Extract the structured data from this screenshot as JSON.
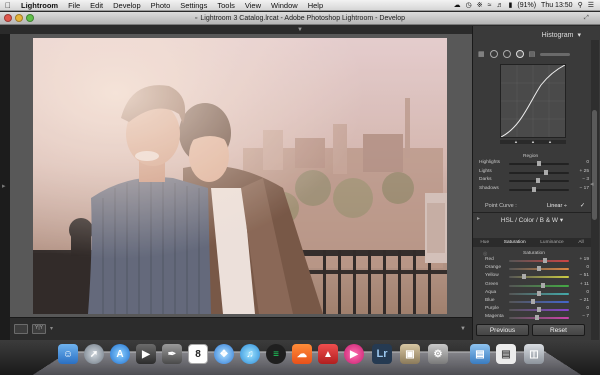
{
  "menubar": {
    "apple": "",
    "items": [
      "Lightroom",
      "File",
      "Edit",
      "Develop",
      "Photo",
      "Settings",
      "Tools",
      "View",
      "Window",
      "Help"
    ],
    "battery": "(91%)",
    "clock": "Thu 13:50"
  },
  "window": {
    "title": "Lightroom 3 Catalog.lrcat - Adobe Photoshop Lightroom - Develop"
  },
  "histogram": {
    "title": "Histogram"
  },
  "tone_curve": {
    "region_label": "Region",
    "sliders": [
      {
        "label": "Highlights",
        "value": "0",
        "level": 0.5
      },
      {
        "label": "Lights",
        "value": "+ 25",
        "level": 0.62
      },
      {
        "label": "Darks",
        "value": "− 3",
        "level": 0.48
      },
      {
        "label": "Shadows",
        "value": "− 17",
        "level": 0.42
      }
    ],
    "point_curve_label": "Point Curve :",
    "point_curve_value": "Linear ÷"
  },
  "hsl": {
    "title": "HSL / Color / B & W ▾",
    "tabs": [
      "Hue",
      "Saturation",
      "Luminance",
      "All"
    ],
    "active_tab": "Saturation",
    "section_label": "Saturation",
    "sliders": [
      {
        "label": "Red",
        "value": "+ 19",
        "color": "#c44",
        "level": 0.6
      },
      {
        "label": "Orange",
        "value": "0",
        "color": "#d84",
        "level": 0.5
      },
      {
        "label": "Yellow",
        "value": "− 51",
        "color": "#cc4",
        "level": 0.25
      },
      {
        "label": "Green",
        "value": "+ 11",
        "color": "#4a4",
        "level": 0.56
      },
      {
        "label": "Aqua",
        "value": "0",
        "color": "#4aa",
        "level": 0.5
      },
      {
        "label": "Blue",
        "value": "− 21",
        "color": "#46c",
        "level": 0.4
      },
      {
        "label": "Purple",
        "value": "0",
        "color": "#84c",
        "level": 0.5
      },
      {
        "label": "Magenta",
        "value": "− 7",
        "color": "#c4a",
        "level": 0.46
      }
    ]
  },
  "buttons": {
    "previous": "Previous",
    "reset": "Reset"
  },
  "dock": {
    "calendar_day": "8",
    "lr_label": "Lr"
  }
}
